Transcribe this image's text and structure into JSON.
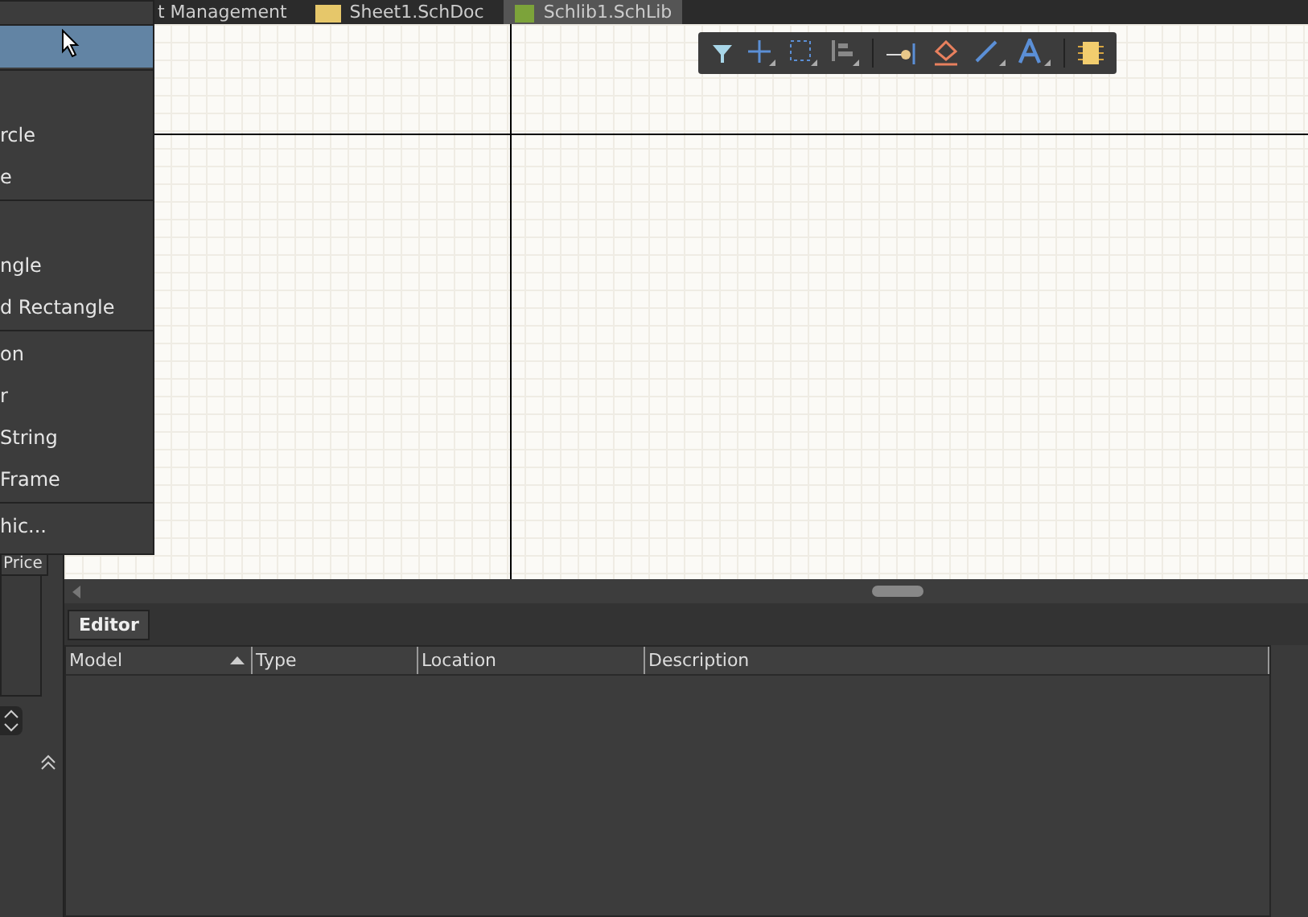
{
  "document_tabs": [
    {
      "label": "t Management",
      "selected": false,
      "kind": "plain"
    },
    {
      "label": "Sheet1.SchDoc",
      "selected": false,
      "kind": "sheet"
    },
    {
      "label": "Schlib1.SchLib",
      "selected": true,
      "kind": "lib"
    }
  ],
  "place_menu": {
    "items": [
      {
        "kind": "item",
        "selected": true
      },
      {
        "kind": "separator"
      },
      {
        "kind": "blank"
      },
      {
        "kind": "item",
        "label": "rcle",
        "selected": false
      },
      {
        "kind": "item",
        "label": "e",
        "selected": false
      },
      {
        "kind": "separator"
      },
      {
        "kind": "blank"
      },
      {
        "kind": "item",
        "label": "ngle",
        "selected": false
      },
      {
        "kind": "item",
        "label": "d Rectangle",
        "selected": false
      },
      {
        "kind": "separator"
      },
      {
        "kind": "item",
        "label": "on",
        "selected": false
      },
      {
        "kind": "item",
        "label": "r",
        "selected": false
      },
      {
        "kind": "item",
        "label": "String",
        "selected": false
      },
      {
        "kind": "item",
        "label": "Frame",
        "selected": false
      },
      {
        "kind": "separator"
      },
      {
        "kind": "item",
        "label": "hic...",
        "selected": false
      }
    ]
  },
  "left_panel": {
    "column_header": "Price"
  },
  "bottom_panel": {
    "tabs": [
      {
        "label": "Editor",
        "selected": true
      }
    ],
    "table": {
      "columns": [
        {
          "label": "Model",
          "sorted": true
        },
        {
          "label": "Type",
          "sorted": false
        },
        {
          "label": "Location",
          "sorted": false
        },
        {
          "label": "Description",
          "sorted": false
        }
      ]
    }
  }
}
